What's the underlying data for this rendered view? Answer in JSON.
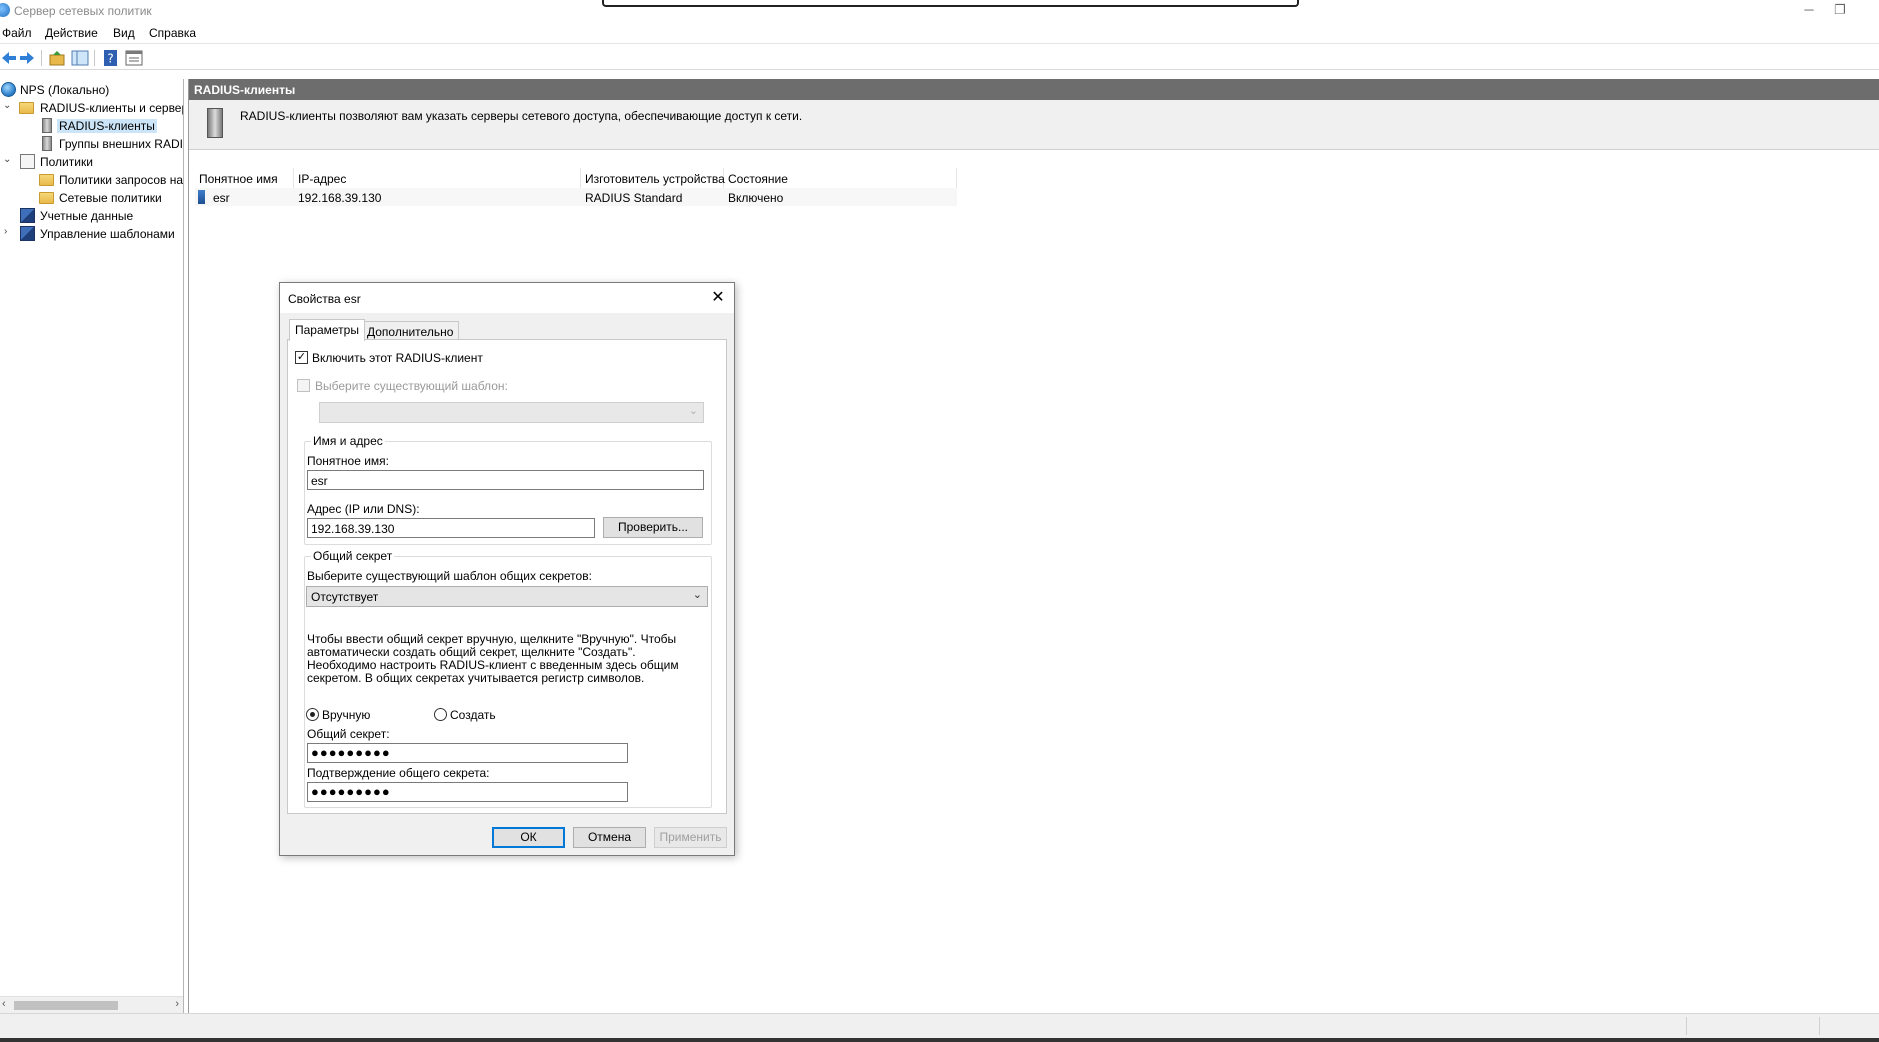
{
  "window": {
    "title": "Сервер сетевых политик"
  },
  "menu": [
    "Файл",
    "Действие",
    "Вид",
    "Справка"
  ],
  "tree": {
    "items": [
      {
        "label": "NPS (Локально)"
      },
      {
        "label": "RADIUS-клиенты и серверы"
      },
      {
        "label": "RADIUS-клиенты"
      },
      {
        "label": "Группы внешних RADIUS-серверов"
      },
      {
        "label": "Политики"
      },
      {
        "label": "Политики запросов на подключение"
      },
      {
        "label": "Сетевые политики"
      },
      {
        "label": "Учетные данные"
      },
      {
        "label": "Управление шаблонами"
      }
    ]
  },
  "content": {
    "header": "RADIUS-клиенты",
    "description": "RADIUS-клиенты позволяют вам указать серверы сетевого доступа, обеспечивающие доступ к сети.",
    "columns": [
      "Понятное имя",
      "IP-адрес",
      "Изготовитель устройства",
      "Состояние"
    ],
    "rows": [
      {
        "name": "esr",
        "ip": "192.168.39.130",
        "vendor": "RADIUS Standard",
        "state": "Включено"
      }
    ]
  },
  "dialog": {
    "title": "Свойства esr",
    "tabs": [
      "Параметры",
      "Дополнительно"
    ],
    "enable_label": "Включить этот RADIUS-клиент",
    "enable_checked": true,
    "template_label": "Выберите существующий шаблон:",
    "template_value": "",
    "name_group_title": "Имя и адрес",
    "friendly_name_label": "Понятное имя:",
    "friendly_name_value": "esr",
    "address_label": "Адрес (IP или DNS):",
    "address_value": "192.168.39.130",
    "verify_button": "Проверить...",
    "secret_group_title": "Общий секрет",
    "secret_template_label": "Выберите существующий шаблон общих секретов:",
    "secret_template_value": "Отсутствует",
    "secret_help": "Чтобы ввести общий секрет вручную, щелкните \"Вручную\". Чтобы автоматически создать общий секрет, щелкните \"Создать\". Необходимо настроить RADIUS-клиент с введенным здесь общим секретом. В общих секретах учитывается регистр символов.",
    "radio_manual": "Вручную",
    "radio_generate": "Создать",
    "secret_label": "Общий секрет:",
    "secret_value": "●●●●●●●●●",
    "confirm_label": "Подтверждение общего секрета:",
    "confirm_value": "●●●●●●●●●",
    "ok_button": "ОК",
    "cancel_button": "Отмена",
    "apply_button": "Применить"
  }
}
